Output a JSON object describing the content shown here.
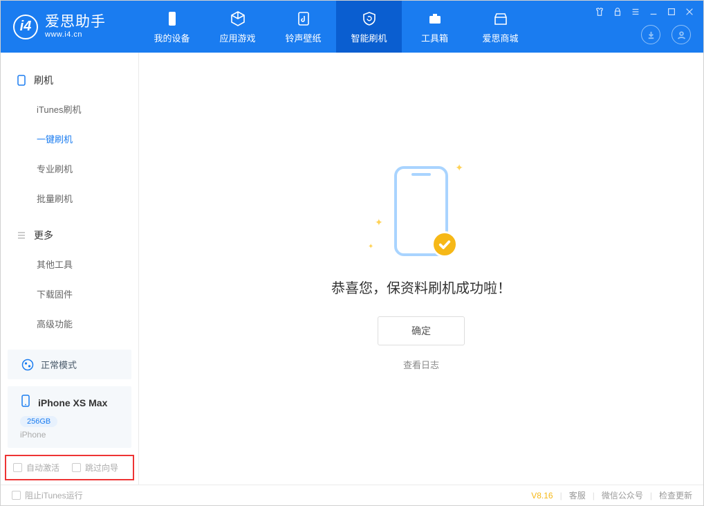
{
  "app": {
    "brand": "爱思助手",
    "url": "www.i4.cn"
  },
  "tabs": {
    "device": "我的设备",
    "apps": "应用游戏",
    "ringtones": "铃声壁纸",
    "flash": "智能刷机",
    "toolbox": "工具箱",
    "shop": "爱思商城"
  },
  "sidebar": {
    "flash_header": "刷机",
    "items": {
      "itunes": "iTunes刷机",
      "oneclick": "一键刷机",
      "pro": "专业刷机",
      "batch": "批量刷机"
    },
    "more_header": "更多",
    "more": {
      "other": "其他工具",
      "download": "下载固件",
      "advanced": "高级功能"
    }
  },
  "mode": {
    "label": "正常模式"
  },
  "device": {
    "name": "iPhone XS Max",
    "capacity": "256GB",
    "subtype": "iPhone"
  },
  "options": {
    "auto_activate": "自动激活",
    "skip_guide": "跳过向导"
  },
  "main": {
    "title": "恭喜您，保资料刷机成功啦！",
    "ok": "确定",
    "log": "查看日志"
  },
  "footer": {
    "block_itunes": "阻止iTunes运行",
    "version": "V8.16",
    "support": "客服",
    "wechat": "微信公众号",
    "update": "检查更新"
  }
}
